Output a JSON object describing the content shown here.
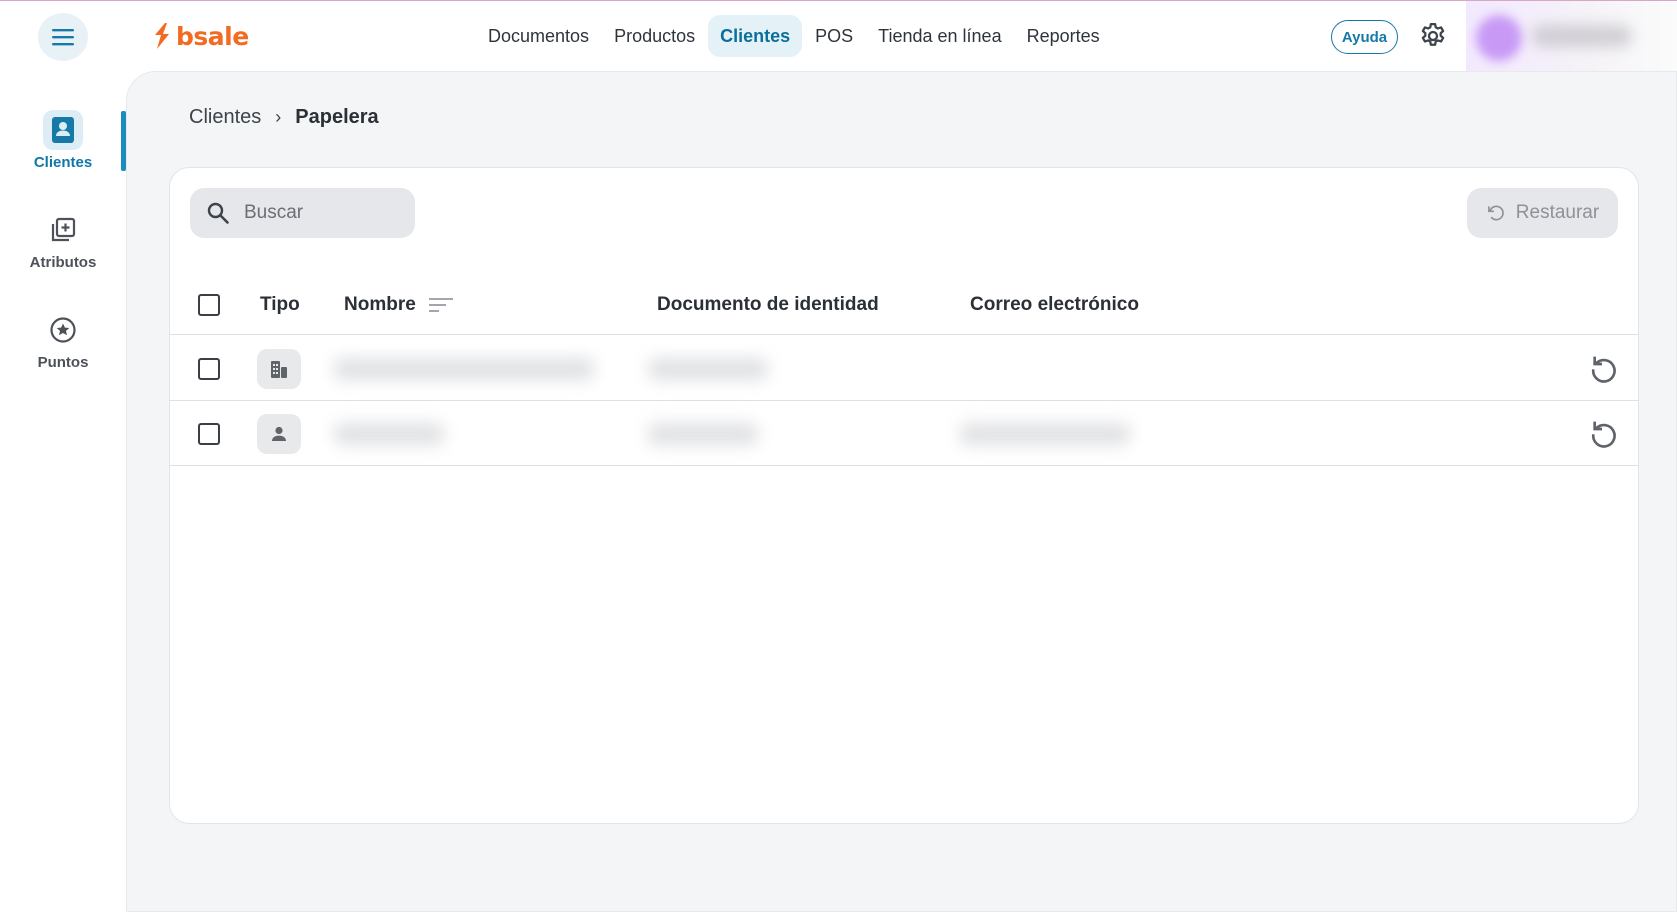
{
  "header": {
    "logo_text": "bsale",
    "nav": [
      {
        "label": "Documentos",
        "active": false
      },
      {
        "label": "Productos",
        "active": false
      },
      {
        "label": "Clientes",
        "active": true
      },
      {
        "label": "POS",
        "active": false
      },
      {
        "label": "Tienda en línea",
        "active": false
      },
      {
        "label": "Reportes",
        "active": false
      }
    ],
    "help_label": "Ayuda"
  },
  "sidebar": {
    "items": [
      {
        "label": "Clientes",
        "icon": "contact-card-icon",
        "active": true
      },
      {
        "label": "Atributos",
        "icon": "add-library-icon",
        "active": false
      },
      {
        "label": "Puntos",
        "icon": "star-circle-icon",
        "active": false
      }
    ]
  },
  "breadcrumb": {
    "root": "Clientes",
    "separator": "›",
    "current": "Papelera"
  },
  "toolbar": {
    "search_placeholder": "Buscar",
    "restore_label": "Restaurar"
  },
  "table": {
    "columns": {
      "type": "Tipo",
      "name": "Nombre",
      "document": "Documento de identidad",
      "email": "Correo electrónico"
    },
    "rows": [
      {
        "type_icon": "company-icon",
        "name": "",
        "document": "",
        "email": ""
      },
      {
        "type_icon": "person-icon",
        "name": "",
        "document": "",
        "email": ""
      }
    ]
  },
  "colors": {
    "brand": "#f26b21",
    "accent": "#1679a8",
    "panel_bg": "#f4f5f7"
  }
}
